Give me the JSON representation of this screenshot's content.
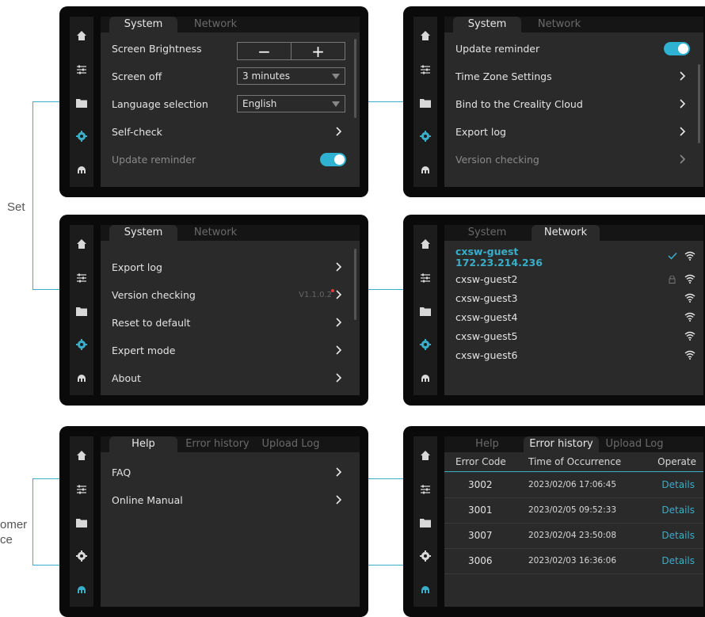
{
  "labels": {
    "set": "Set",
    "customer_line1": "omer",
    "customer_line2": "ce"
  },
  "colors": {
    "accent": "#3aaec8",
    "background": "#0a0a0a",
    "panel": "#2a2a2a"
  },
  "nav_icons": [
    "home-icon",
    "sliders-icon",
    "folder-icon",
    "gear-icon",
    "robot-icon"
  ],
  "screen1": {
    "tabs": [
      "System",
      "Network"
    ],
    "rows": [
      {
        "label": "Screen Brightness"
      },
      {
        "label": "Screen off",
        "value": "3 minutes"
      },
      {
        "label": "Language selection",
        "value": "English"
      },
      {
        "label": "Self-check"
      },
      {
        "label": "Update reminder"
      }
    ],
    "stepper_minus": "−",
    "stepper_plus": "+"
  },
  "screen2": {
    "tabs": [
      "System",
      "Network"
    ],
    "rows": [
      {
        "label": "Update reminder"
      },
      {
        "label": "Time Zone Settings"
      },
      {
        "label": "Bind to the Creality Cloud"
      },
      {
        "label": "Export log"
      },
      {
        "label": "Version checking"
      }
    ]
  },
  "screen3": {
    "tabs": [
      "System",
      "Network"
    ],
    "rows": [
      {
        "label": "Export log"
      },
      {
        "label": "Version checking",
        "value": "V1.1.0.2"
      },
      {
        "label": "Reset to default"
      },
      {
        "label": "Expert mode"
      },
      {
        "label": "About"
      }
    ]
  },
  "screen4": {
    "tabs": [
      "System",
      "Network"
    ],
    "connected": {
      "name": "cxsw-guest",
      "ip": "172.23.214.236"
    },
    "networks": [
      "cxsw-guest2",
      "cxsw-guest3",
      "cxsw-guest4",
      "cxsw-guest5",
      "cxsw-guest6"
    ]
  },
  "screen5": {
    "tabs": [
      "Help",
      "Error history",
      "Upload Log"
    ],
    "rows": [
      {
        "label": "FAQ"
      },
      {
        "label": "Online Manual"
      }
    ]
  },
  "screen6": {
    "tabs": [
      "Help",
      "Error history",
      "Upload Log"
    ],
    "headers": [
      "Error Code",
      "Time of Occurrence",
      "Operate"
    ],
    "errors": [
      {
        "code": "3002",
        "time": "2023/02/06  17:06:45",
        "action": "Details"
      },
      {
        "code": "3001",
        "time": "2023/02/05  09:52:33",
        "action": "Details"
      },
      {
        "code": "3007",
        "time": "2023/02/04  23:50:08",
        "action": "Details"
      },
      {
        "code": "3006",
        "time": "2023/02/03  16:36:06",
        "action": "Details"
      }
    ]
  }
}
